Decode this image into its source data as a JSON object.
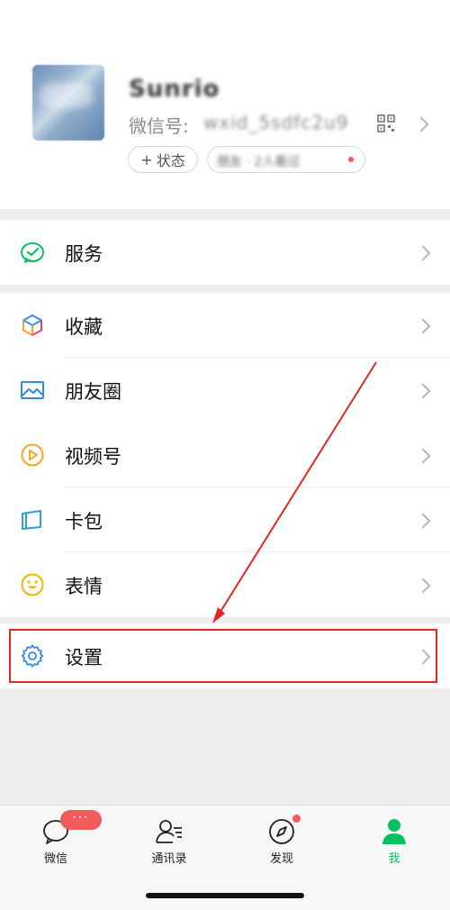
{
  "profile": {
    "nickname": "Sunrio",
    "wechat_id_label": "微信号:",
    "wechat_id_value": "wxid_5sdfc2u9",
    "status_button": "状态",
    "status_plus": "+",
    "friend_status_text": "朋友 · 2人看过"
  },
  "menu": {
    "service": "服务",
    "favorites": "收藏",
    "moments": "朋友圈",
    "channels": "视频号",
    "cards": "卡包",
    "stickers": "表情",
    "settings": "设置"
  },
  "tabbar": {
    "chats": "微信",
    "contacts": "通讯录",
    "discover": "发现",
    "me": "我",
    "chats_badge": "···"
  },
  "colors": {
    "accent_green": "#07c160",
    "annotation_red": "#e02a21",
    "badge_red": "#f15b5b"
  },
  "icons": {
    "service": "wechat-pay-icon",
    "favorites": "cube-icon",
    "moments": "image-icon",
    "channels": "play-circle-icon",
    "cards": "card-wallet-icon",
    "stickers": "smiley-icon",
    "settings": "gear-icon"
  }
}
